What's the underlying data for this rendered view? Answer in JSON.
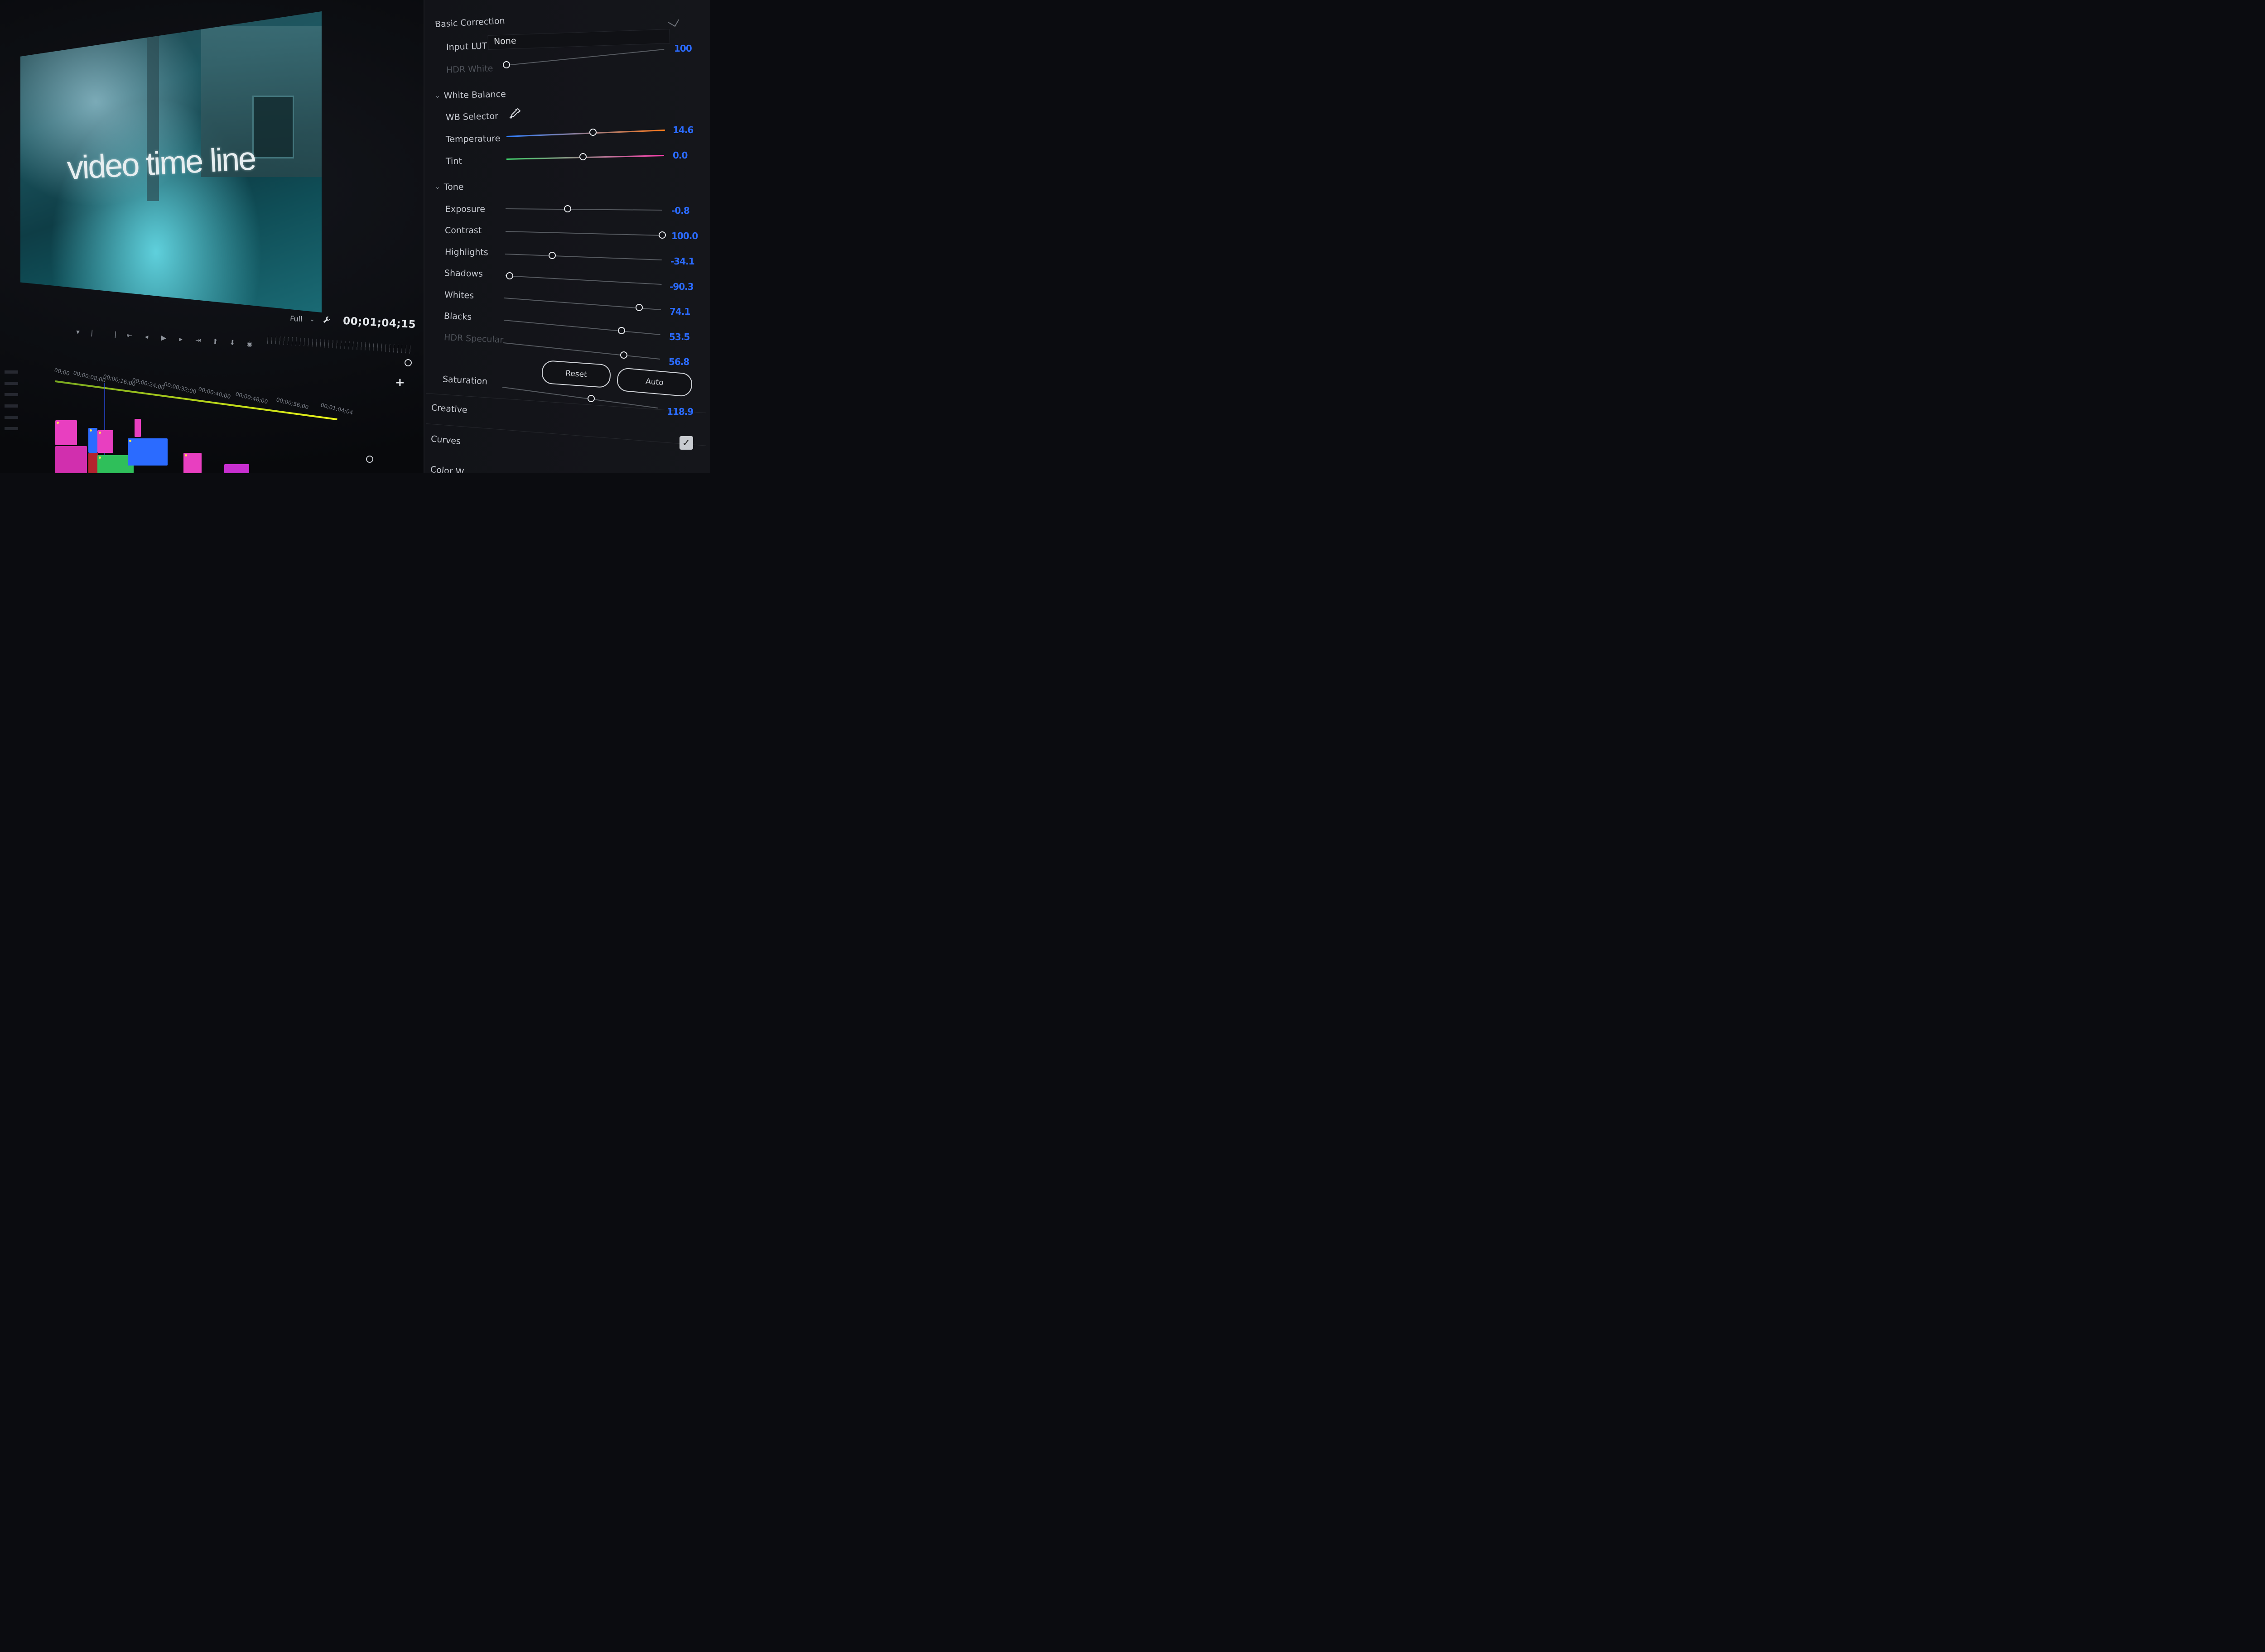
{
  "monitor": {
    "caption": "video time line",
    "fit": "Full",
    "timecode": "00;01;04;15"
  },
  "timeline": {
    "ruler": [
      "00;00",
      "00;00;08;00",
      "00;00;16;00",
      "00;00;24;00",
      "00;00;32;00",
      "00;00;40;00",
      "00;00;48;00",
      "00;00;56;00",
      "00;01;04;04"
    ]
  },
  "panel": {
    "basic_correction": "Basic Correction",
    "input_lut_label": "Input LUT",
    "input_lut_value": "None",
    "hdr_white_label": "HDR White",
    "hdr_white_value": "100",
    "white_balance": "White Balance",
    "wb_selector": "WB Selector",
    "temperature_label": "Temperature",
    "temperature_value": "14.6",
    "tint_label": "Tint",
    "tint_value": "0.0",
    "tone": "Tone",
    "exposure_label": "Exposure",
    "exposure_value": "-0.8",
    "contrast_label": "Contrast",
    "contrast_value": "100.0",
    "highlights_label": "Highlights",
    "highlights_value": "-34.1",
    "shadows_label": "Shadows",
    "shadows_value": "-90.3",
    "whites_label": "Whites",
    "whites_value": "74.1",
    "blacks_label": "Blacks",
    "blacks_value": "53.5",
    "hdr_specular_label": "HDR Specular",
    "hdr_specular_value": "56.8",
    "reset": "Reset",
    "auto": "Auto",
    "saturation_label": "Saturation",
    "saturation_value": "118.9",
    "creative": "Creative",
    "curves": "Curves",
    "color_wheels": "Color W"
  },
  "colors": {
    "accent": "#2b6bff",
    "temp_cool": "#2f7fff",
    "temp_warm": "#ff7a1a",
    "tint_green": "#3fd06a",
    "tint_magenta": "#ff3fb0",
    "work_area": "#c8e018"
  }
}
